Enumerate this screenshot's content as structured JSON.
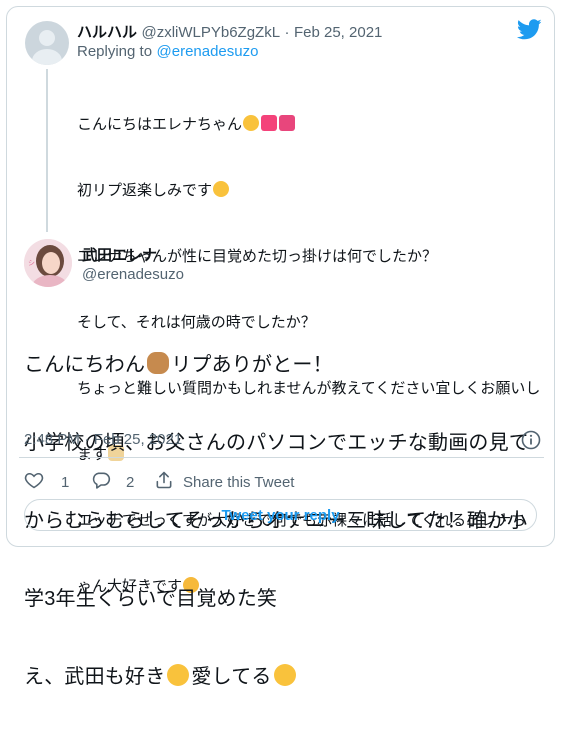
{
  "colors": {
    "accent": "#1d9bf0",
    "text": "#0f1419",
    "muted": "#536471",
    "border": "#cfd9de"
  },
  "parent": {
    "name": "ハルハル",
    "handle": "@zxliWLPYb6ZgZkL",
    "separator": "·",
    "date": "Feb 25, 2021",
    "replying_label": "Replying to",
    "replying_handle": "@erenadesuzo",
    "lines": [
      "こんにちはエレナちゃん",
      "初リプ返楽しみです",
      "エレナちゃんが性に目覚めた切っ掛けは何でしたか？",
      "そして、それは何歳の時でしたか？",
      "ちょっと難しい質問かもしれませんが教えてください宜しくお願いし",
      "ます",
      "エッチでせっくすが大好きで何でも赤裸々に話してくれるエレナち",
      "ゃん大好きです"
    ]
  },
  "main": {
    "name": "武田エレナ",
    "handle": "@erenadesuzo",
    "lines": [
      "こんにちわん",
      "リプありがとー！",
      "小学校の頃、お父さんのパソコンでエッチな動画の見て",
      "からむらむらしてそっからオナニー三昧してた！確か小",
      "学3年生くらいで目覚めた笑",
      "え、武田も好き",
      "愛してる"
    ],
    "time": "2:48 PM",
    "separator": "·",
    "date": "Feb 25, 2021"
  },
  "actions": {
    "like_count": "1",
    "reply_count": "2",
    "share_label": "Share this Tweet"
  },
  "reply_button": "Tweet your reply",
  "icons": [
    "twitter-bird-icon",
    "heart-icon",
    "comment-icon",
    "share-icon",
    "info-icon"
  ]
}
